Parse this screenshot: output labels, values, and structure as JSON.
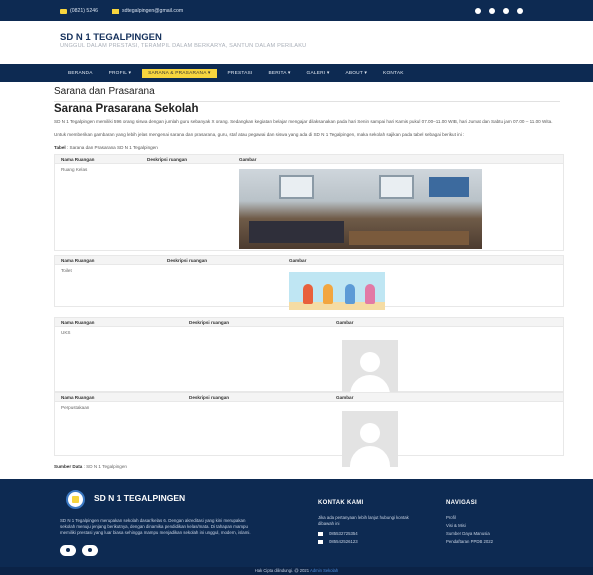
{
  "topbar": {
    "phone": "(0821) 5246",
    "email": "sdtegalpingen@gmail.com"
  },
  "header": {
    "title": "SD N 1 TEGALPINGEN",
    "tagline": "UNGGUL DALAM PRESTASI, TERAMPIL DALAM BERKARYA, SANTUN DALAM PERILAKU"
  },
  "nav": {
    "items": [
      {
        "label": "BERANDA"
      },
      {
        "label": "PROFIL ▾"
      },
      {
        "label": "SARANA & PRASARANA ▾"
      },
      {
        "label": "PRESTASI"
      },
      {
        "label": "BERITA ▾"
      },
      {
        "label": "GALERI ▾"
      },
      {
        "label": "ABOUT ▾"
      },
      {
        "label": "KONTAK"
      }
    ]
  },
  "main": {
    "page_title": "Sarana dan Prasarana",
    "section_title": "Sarana Prasarana Sekolah",
    "para1": "SD N 1 Tegalpingen memiliki 596 orang siswa dengan jumlah guru sebanyak X orang. Sedangkan kegiatan belajar mengajar dilaksanakan pada hari Senin sampai hari Kamis pukul 07.00–11.00 WIB, hari Jumat dan Sabtu jam 07.00 – 11.00 Wita.",
    "para2": "Untuk memberikan gambaran yang lebih jelas mengenai sarana dan prasarana, guru, staf atau pegawai dan siswa yang ada di SD N 1 Tegalpingen, maka sekolah sajikan pada tabel sebagai berikut ini :",
    "caption_label": "Tabel",
    "caption_text": ": Sarana dan Prasarana SD N 1 Tegalpingen",
    "col_name": "Nama Ruangan",
    "col_desc": "Deskripsi ruangan",
    "col_img": "Gambar",
    "rooms": [
      {
        "name": "Ruang Kelas"
      },
      {
        "name": "Toilet"
      },
      {
        "name": "UKS"
      },
      {
        "name": "Perpustakaan"
      }
    ],
    "source_label": "Sumber Data",
    "source_text": ": SD N 1 Tegalpingen"
  },
  "footer": {
    "title": "SD N 1 TEGALPINGEN",
    "description": "SD N 1 Tegalpingen merupakan sekolah dasar/kelas 6. Dengan akreditasi yang kini merupakan sekolah menuju jenjang berikutnya, dengan dinamika pendidikan kelas/mata. Di tahapan mampu memiliki prestasi yang luar biasa sehingga mampu menjadikan sekolah ini unggul, modern, islami.",
    "contact_heading": "KONTAK KAMI",
    "contact_note": "Jika ada pertanyaan lebih lanjut hubungi kontak dibawah ini",
    "phone": "085532725354",
    "phone2": "085542526123",
    "nav_heading": "NAVIGASI",
    "nav_links": [
      "Profil",
      "Visi & Misi",
      "Sumber Daya Manusia",
      "Pendaftaran PPDB 2022"
    ],
    "copyright": "Hak Cipta dilindungi. @ 2021",
    "copyright_link": "Admin Sekolah"
  }
}
